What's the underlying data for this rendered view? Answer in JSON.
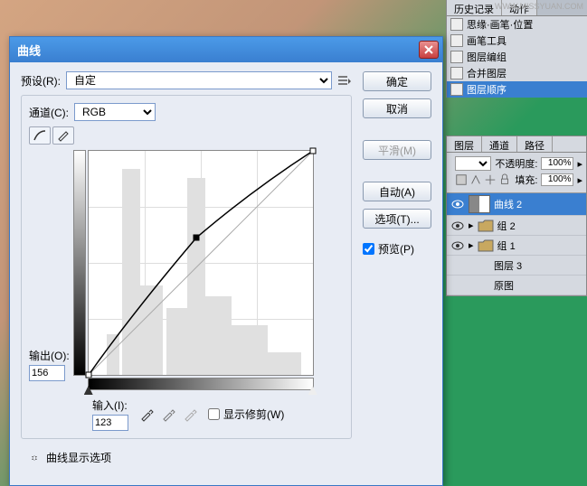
{
  "dialog": {
    "title": "曲线",
    "preset_label": "预设(R):",
    "preset_value": "自定",
    "channel_label": "通道(C):",
    "channel_value": "RGB",
    "output_label": "输出(O):",
    "output_value": "156",
    "input_label": "输入(I):",
    "input_value": "123",
    "show_clip_label": "显示修剪(W)",
    "expand_label": "曲线显示选项",
    "buttons": {
      "ok": "确定",
      "cancel": "取消",
      "smooth": "平滑(M)",
      "auto": "自动(A)",
      "options": "选项(T)...",
      "preview": "预览(P)"
    }
  },
  "history": {
    "tabs": [
      "历史记录",
      "动作"
    ],
    "items": [
      {
        "label": "思缘·画笔·位置",
        "selected": false
      },
      {
        "label": "画笔工具",
        "selected": false
      },
      {
        "label": "图层编组",
        "selected": false
      },
      {
        "label": "合并图层",
        "selected": false
      },
      {
        "label": "图层顺序",
        "selected": true
      }
    ]
  },
  "layers": {
    "tabs": [
      "图层",
      "通道",
      "路径"
    ],
    "opacity_label": "不透明度:",
    "opacity_value": "100%",
    "fill_label": "填充:",
    "fill_value": "100%",
    "items": [
      {
        "label": "曲线 2",
        "selected": true,
        "type": "adjustment"
      },
      {
        "label": "组 2",
        "selected": false,
        "type": "group"
      },
      {
        "label": "组 1",
        "selected": false,
        "type": "group"
      },
      {
        "label": "图层 3",
        "selected": false,
        "type": "layer"
      },
      {
        "label": "原图",
        "selected": false,
        "type": "layer"
      }
    ]
  },
  "watermark": "WWW.MISSYUAN.COM",
  "chart_data": {
    "type": "line",
    "title": "曲线",
    "xlabel": "输入",
    "ylabel": "输出",
    "xlim": [
      0,
      255
    ],
    "ylim": [
      0,
      255
    ],
    "series": [
      {
        "name": "curve",
        "points": [
          [
            0,
            0
          ],
          [
            49,
            70
          ],
          [
            123,
            156
          ],
          [
            186,
            210
          ],
          [
            255,
            255
          ]
        ]
      },
      {
        "name": "baseline",
        "points": [
          [
            0,
            0
          ],
          [
            255,
            255
          ]
        ]
      }
    ],
    "active_point": {
      "input": 123,
      "output": 156
    }
  }
}
